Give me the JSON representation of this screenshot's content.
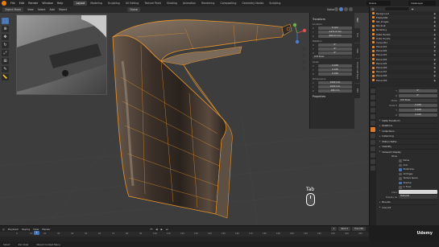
{
  "menu": {
    "items": [
      "File",
      "Edit",
      "Render",
      "Window",
      "Help"
    ],
    "workspaces": [
      "Layout",
      "Modeling",
      "Sculpting",
      "UV Editing",
      "Texture Paint",
      "Shading",
      "Animation",
      "Rendering",
      "Compositing",
      "Geometry Nodes",
      "Scripting"
    ],
    "active_workspace": "Layout",
    "scene": "Scene",
    "view_layer": "ViewLayer"
  },
  "viewport_header": {
    "mode": "Object Mode",
    "menus": [
      "View",
      "Select",
      "Add",
      "Object"
    ],
    "transform_orientation": "Global",
    "options_label": "Options"
  },
  "npanel": {
    "tabs": [
      "Item",
      "Tool",
      "View",
      "Screencast Keys",
      "Edit"
    ],
    "active_tab": "Item",
    "transform_label": "Transform",
    "location_label": "Location",
    "location": [
      {
        "axis": "X",
        "value": "0 mm"
      },
      {
        "axis": "Y",
        "value": "-1471.9 mm"
      },
      {
        "axis": "Z",
        "value": "984.57 mm"
      }
    ],
    "rotation_label": "Rotation",
    "rotation": [
      {
        "axis": "X",
        "value": "0°"
      },
      {
        "axis": "Y",
        "value": "0°"
      },
      {
        "axis": "Z",
        "value": "0°"
      }
    ],
    "rotation_mode": "XYZ Euler",
    "scale_label": "Scale",
    "scale": [
      {
        "axis": "X",
        "value": "0.108"
      },
      {
        "axis": "Y",
        "value": "0.108"
      },
      {
        "axis": "Z",
        "value": "0.108"
      }
    ],
    "dimensions_label": "Dimensions",
    "dimensions": [
      {
        "axis": "X",
        "value": "1909 mm"
      },
      {
        "axis": "Y",
        "value": "1000 mm"
      },
      {
        "axis": "Z",
        "value": "186 mm"
      }
    ],
    "properties_label": "Properties"
  },
  "outliner": {
    "items": [
      {
        "name": "Background",
        "type": "mesh"
      },
      {
        "name": "Empty.009",
        "type": "mesh"
      },
      {
        "name": "Ref_Images",
        "type": "mesh"
      },
      {
        "name": "Blockout",
        "type": "mesh"
      },
      {
        "name": "Modelling",
        "type": "mesh"
      },
      {
        "name": "Delta Handle",
        "type": "mesh"
      },
      {
        "name": "Delta Handle",
        "type": "mesh"
      },
      {
        "name": "Curve.001",
        "type": "mesh"
      },
      {
        "name": "Plane.001",
        "type": "mesh"
      },
      {
        "name": "Plane.002",
        "type": "mesh"
      },
      {
        "name": "Plane.003",
        "type": "mesh"
      },
      {
        "name": "Plane.004",
        "type": "mesh"
      },
      {
        "name": "Plane.005",
        "type": "mesh"
      },
      {
        "name": "Plane.006",
        "type": "mesh"
      },
      {
        "name": "Plane.007",
        "type": "mesh"
      },
      {
        "name": "Plane.008",
        "type": "mesh"
      },
      {
        "name": "Plane.009",
        "type": "mesh"
      }
    ]
  },
  "properties": {
    "transform_rows": [
      {
        "key": "Y",
        "value": "0°"
      },
      {
        "key": "Z",
        "value": "0°"
      }
    ],
    "mode_label": "Mode",
    "mode_value": "XYZ Euler",
    "scale_label": "Scale X",
    "scale_rows": [
      {
        "key": "Scale X",
        "value": "0.108"
      },
      {
        "key": "Y",
        "value": "0.108"
      },
      {
        "key": "Z",
        "value": "0.108"
      }
    ],
    "delta_label": "Delta Transform",
    "sections": [
      "Relations",
      "Collections",
      "Instancing",
      "Motion Paths",
      "Visibility"
    ],
    "viewport_display_label": "Viewport Display",
    "show_label": "Show",
    "show_checks": [
      {
        "label": "Name",
        "on": false
      },
      {
        "label": "Axis",
        "on": false
      },
      {
        "label": "Wireframe",
        "on": true
      },
      {
        "label": "All Edges",
        "on": false
      },
      {
        "label": "Texture Space",
        "on": false
      },
      {
        "label": "Shadow",
        "on": true
      },
      {
        "label": "In Front",
        "on": false
      }
    ],
    "color_label": "Color",
    "display_as_label": "Display As",
    "display_as_value": "Textured",
    "bounds_label": "Bounds",
    "line_art_label": "Line Art"
  },
  "timeline": {
    "menus": [
      "Playback",
      "Keying",
      "View",
      "Marker"
    ],
    "current_frame": "1",
    "start_label": "Start",
    "start": "1",
    "end_label": "End",
    "end": "250",
    "ticks": [
      "0",
      "10",
      "20",
      "30",
      "40",
      "50",
      "60",
      "70",
      "80",
      "90",
      "100",
      "110",
      "120",
      "130",
      "140",
      "150",
      "160",
      "170",
      "180",
      "190",
      "200",
      "210",
      "220",
      "230",
      "240",
      "250"
    ]
  },
  "status": {
    "items": [
      "Select",
      "Pan View",
      "Object Context Menu"
    ]
  },
  "overlay": {
    "key_label": "Tab",
    "watermark": "Udemy"
  },
  "colors": {
    "accent": "#4772b3",
    "selection_orange": "#e8952c",
    "viewport_bg": "#3d3d3d"
  }
}
